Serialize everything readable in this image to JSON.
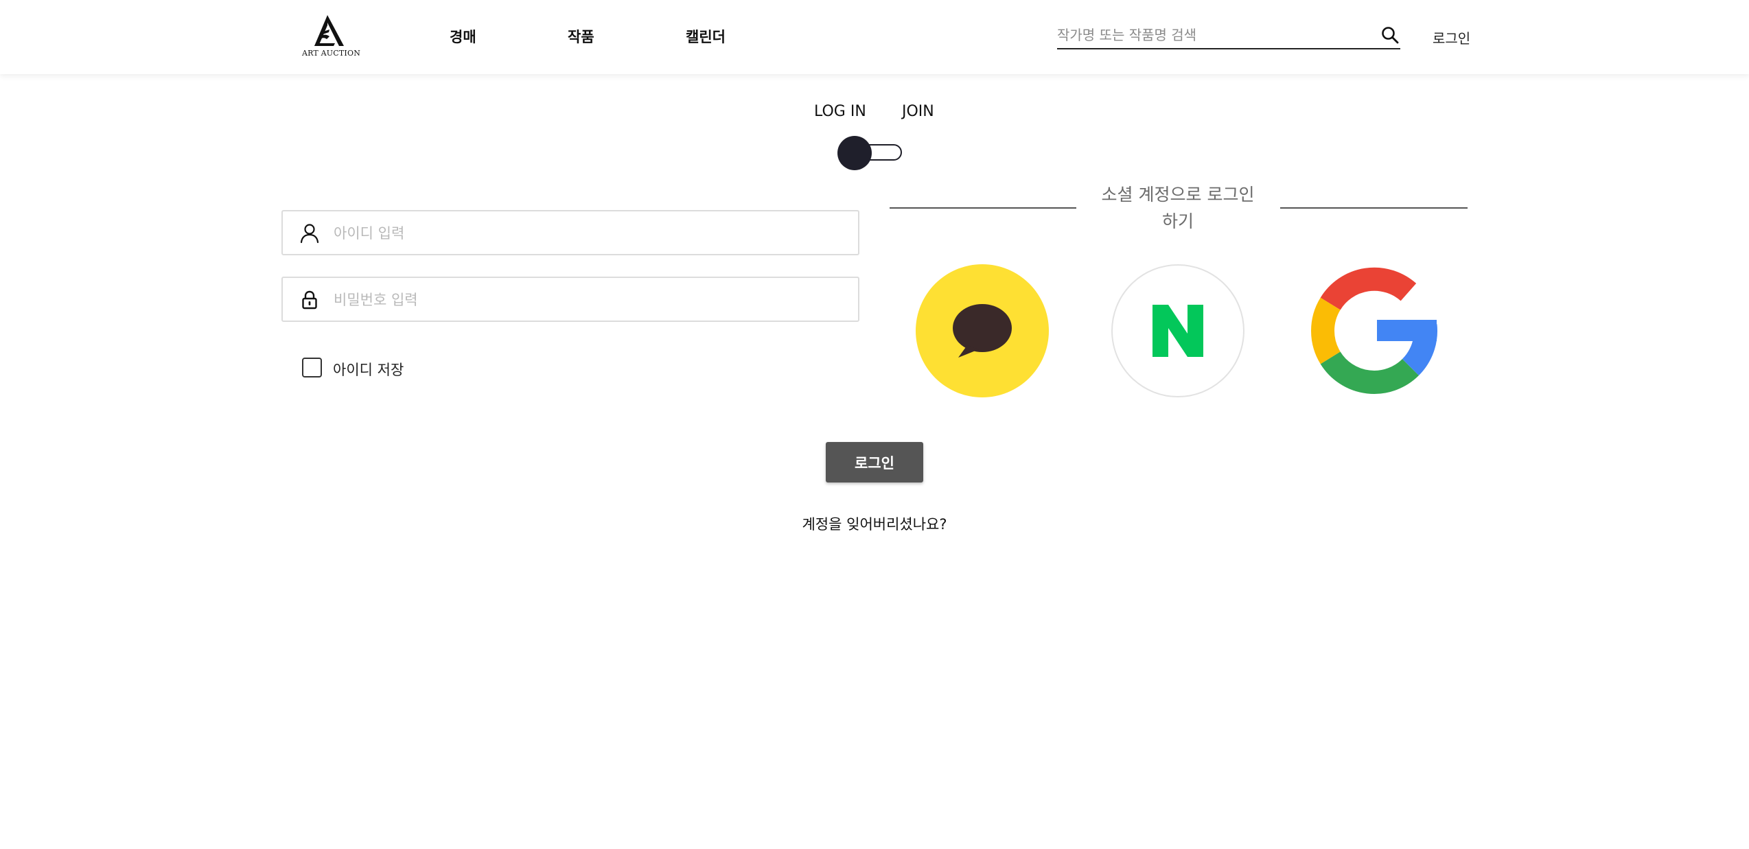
{
  "header": {
    "logo_text": "ART AUCTION",
    "nav": [
      {
        "label": "경매"
      },
      {
        "label": "작품"
      },
      {
        "label": "캘린더"
      }
    ],
    "search": {
      "placeholder": "작가명 또는 작품명 검색",
      "value": "",
      "icon": "search-icon"
    },
    "login_link": "로그인"
  },
  "auth_tabs": {
    "login_label": "LOG IN",
    "join_label": "JOIN",
    "toggle_state": "login"
  },
  "form": {
    "id_field": {
      "placeholder": "아이디 입력",
      "value": "",
      "icon": "user-icon"
    },
    "password_field": {
      "placeholder": "비밀번호 입력",
      "value": "",
      "icon": "lock-icon"
    },
    "remember": {
      "label": "아이디 저장",
      "checked": false
    }
  },
  "social": {
    "title": "소셜 계정으로 로그인하기",
    "providers": [
      {
        "name": "kakao",
        "icon": "kakao-icon",
        "color": "#FEE033"
      },
      {
        "name": "naver",
        "icon": "naver-icon",
        "color": "#03C75A"
      },
      {
        "name": "google",
        "icon": "google-icon",
        "colors": [
          "#EA4335",
          "#FBBC05",
          "#34A853",
          "#4285F4"
        ]
      }
    ]
  },
  "login_button": "로그인",
  "forgot_link": "계정을 잊어버리셨나요?"
}
